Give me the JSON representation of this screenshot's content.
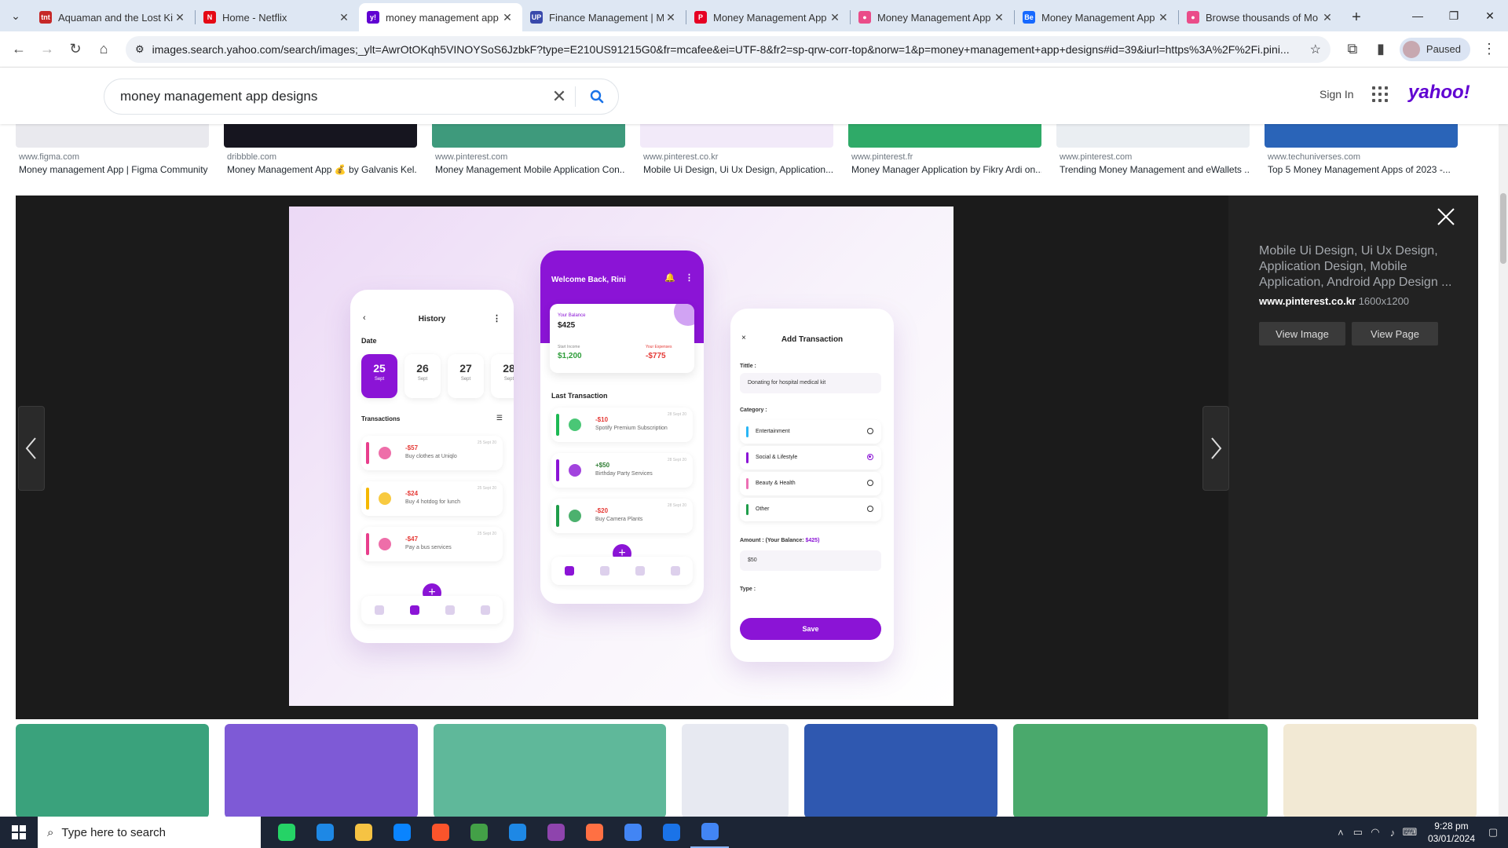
{
  "browser": {
    "tabs": [
      {
        "title": "Aquaman and the Lost Ki",
        "favicon_color": "#c62828",
        "favicon_text": "tnt"
      },
      {
        "title": "Home - Netflix",
        "favicon_color": "#e50914",
        "favicon_text": "N"
      },
      {
        "title": "money management app",
        "favicon_color": "#6001d2",
        "favicon_text": "y!"
      },
      {
        "title": "Finance Management | M",
        "favicon_color": "#3949ab",
        "favicon_text": "UP"
      },
      {
        "title": "Money Management App",
        "favicon_color": "#e60023",
        "favicon_text": "P"
      },
      {
        "title": "Money Management App",
        "favicon_color": "#ea4c89",
        "favicon_text": "●"
      },
      {
        "title": "Money Management App",
        "favicon_color": "#1769ff",
        "favicon_text": "Be"
      },
      {
        "title": "Browse thousands of Mo",
        "favicon_color": "#ea4c89",
        "favicon_text": "●"
      }
    ],
    "url": "images.search.yahoo.com/search/images;_ylt=AwrOtOKqh5VINOYSoS6JzbkF?type=E210US91215G0&fr=mcafee&ei=UTF-8&fr2=sp-qrw-corr-top&norw=1&p=money+management+app+designs#id=39&iurl=https%3A%2F%2Fi.pini...",
    "profile_label": "Paused"
  },
  "yahoo": {
    "query": "money management app designs",
    "signin": "Sign In",
    "logo": "yahoo!"
  },
  "results": [
    {
      "src": "www.figma.com",
      "caption": "Money management App | Figma Community",
      "thumb": "#e9e9ee"
    },
    {
      "src": "dribbble.com",
      "caption": "Money Management App 💰 by Galvanis Kel...",
      "thumb": "#16151f"
    },
    {
      "src": "www.pinterest.com",
      "caption": "Money Management Mobile Application Con...",
      "thumb": "#3e9a7c"
    },
    {
      "src": "www.pinterest.co.kr",
      "caption": "Mobile Ui Design, Ui Ux Design, Application...",
      "thumb": "#f2eaf9"
    },
    {
      "src": "www.pinterest.fr",
      "caption": "Money Manager Application by Fikry Ardi on...",
      "thumb": "#2faa68"
    },
    {
      "src": "www.pinterest.com",
      "caption": "Trending Money Management and eWallets ...",
      "thumb": "#eaeef2"
    },
    {
      "src": "www.techuniverses.com",
      "caption": "Top 5 Money Management Apps of 2023 -...",
      "thumb": "#2a64b8"
    }
  ],
  "viewer": {
    "title": "Mobile Ui Design, Ui Ux Design, Application Design, Mobile Application, Android App Design ...",
    "source": "www.pinterest.co.kr",
    "dimensions": "1600x1200",
    "view_image": "View Image",
    "view_page": "View Page"
  },
  "history_phone": {
    "title": "History",
    "date_label": "Date",
    "dates": [
      {
        "day": "25",
        "month": "Sept"
      },
      {
        "day": "26",
        "month": "Sept"
      },
      {
        "day": "27",
        "month": "Sept"
      },
      {
        "day": "28",
        "month": "Sept"
      }
    ],
    "transactions_label": "Transactions",
    "transactions": [
      {
        "amount": "-$57",
        "desc": "Buy clothes at Uniqlo",
        "date": "25 Sept 20",
        "color": "#e83e8c"
      },
      {
        "amount": "-$24",
        "desc": "Buy 4 hotdog for lunch",
        "date": "25 Sept 20",
        "color": "#f5b800"
      },
      {
        "amount": "-$47",
        "desc": "Pay a bus services",
        "date": "25 Sept 20",
        "color": "#e83e8c"
      }
    ]
  },
  "home_phone": {
    "welcome": "Welcome Back, Rini",
    "balance_label": "Your Balance",
    "balance": "$425",
    "income_label": "Start Income",
    "income": "$1,200",
    "expense_label": "Your Expenses",
    "expense": "-$775",
    "last_label": "Last Transaction",
    "transactions": [
      {
        "amount": "-$10",
        "desc": "Spotify Premium Subscription",
        "date": "28 Sept 20",
        "color": "#1db954",
        "amount_color": "#e53935"
      },
      {
        "amount": "+$50",
        "desc": "Birthday Party Services",
        "date": "28 Sept 20",
        "color": "#8b14d6",
        "amount_color": "#2e7d32"
      },
      {
        "amount": "-$20",
        "desc": "Buy Camera Plants",
        "date": "28 Sept 20",
        "color": "#1f9d4a",
        "amount_color": "#e53935"
      }
    ]
  },
  "add_phone": {
    "title": "Add Transaction",
    "title_label": "Tittle :",
    "title_value": "Donating for hospital medical kit",
    "category_label": "Category :",
    "categories": [
      {
        "label": "Entertainment",
        "color": "#29b6f6",
        "selected": false
      },
      {
        "label": "Social & Lifestyle",
        "color": "#8b14d6",
        "selected": true
      },
      {
        "label": "Beauty & Health",
        "color": "#ec6fb4",
        "selected": false
      },
      {
        "label": "Other",
        "color": "#1f9d4a",
        "selected": false
      }
    ],
    "amount_label": "Amount : (Your Balance:",
    "amount_balance": "$425)",
    "amount_value": "$50",
    "type_label": "Type :",
    "save": "Save"
  },
  "bottom_thumbs": [
    "#3aa27c",
    "#7e5ad6",
    "#5fb89a",
    "#e7e9f1",
    "#2f58b0",
    "#4aa96c",
    "#f2e9d4"
  ],
  "taskbar": {
    "search_placeholder": "Type here to search",
    "apps": [
      "#25d366",
      "#1e88e5",
      "#f6c343",
      "#0a84ff",
      "#fb542b",
      "#43a047",
      "#1e88e5",
      "#8e44ad",
      "#ff7043",
      "#4285f4",
      "#1a73e8",
      "#4285f4"
    ],
    "time": "9:28 pm",
    "date": "03/01/2024"
  }
}
